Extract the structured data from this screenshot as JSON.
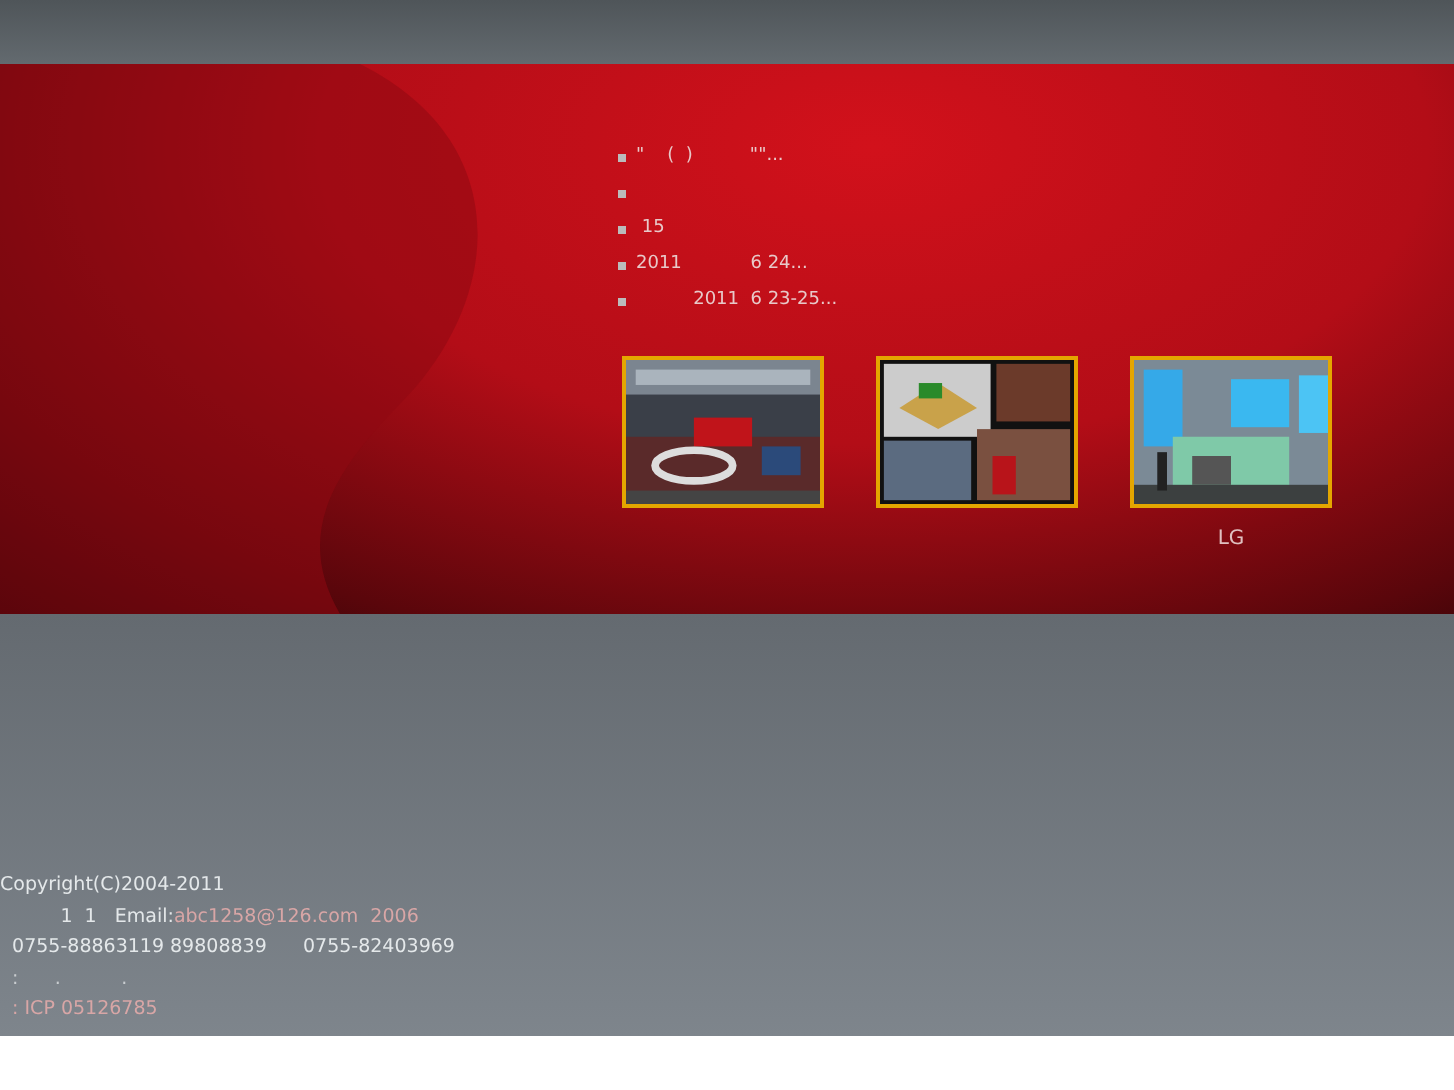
{
  "news": [
    {
      "kind": "link",
      "text": "\"    (  )          \"\"..."
    },
    {
      "kind": "blank"
    },
    {
      "kind": "link",
      "text": " 15"
    },
    {
      "kind": "link",
      "text": "2011            6 24..."
    },
    {
      "kind": "link",
      "text": "          2011  6 23-25..."
    }
  ],
  "photos": [
    {
      "kind": "picture"
    },
    {
      "kind": "picture"
    },
    {
      "kind": "picture",
      "caption": "LG"
    }
  ],
  "footer": {
    "copyright": "Copyright(C)2004-2011",
    "contact_prefix": "          1  1   Email:",
    "contact_link": "abc1258@126.com  2006",
    "phones": "  0755-88863119 89808839      0755-82403969",
    "address": "  :      .          .",
    "icp": "  : ICP 05126785"
  }
}
